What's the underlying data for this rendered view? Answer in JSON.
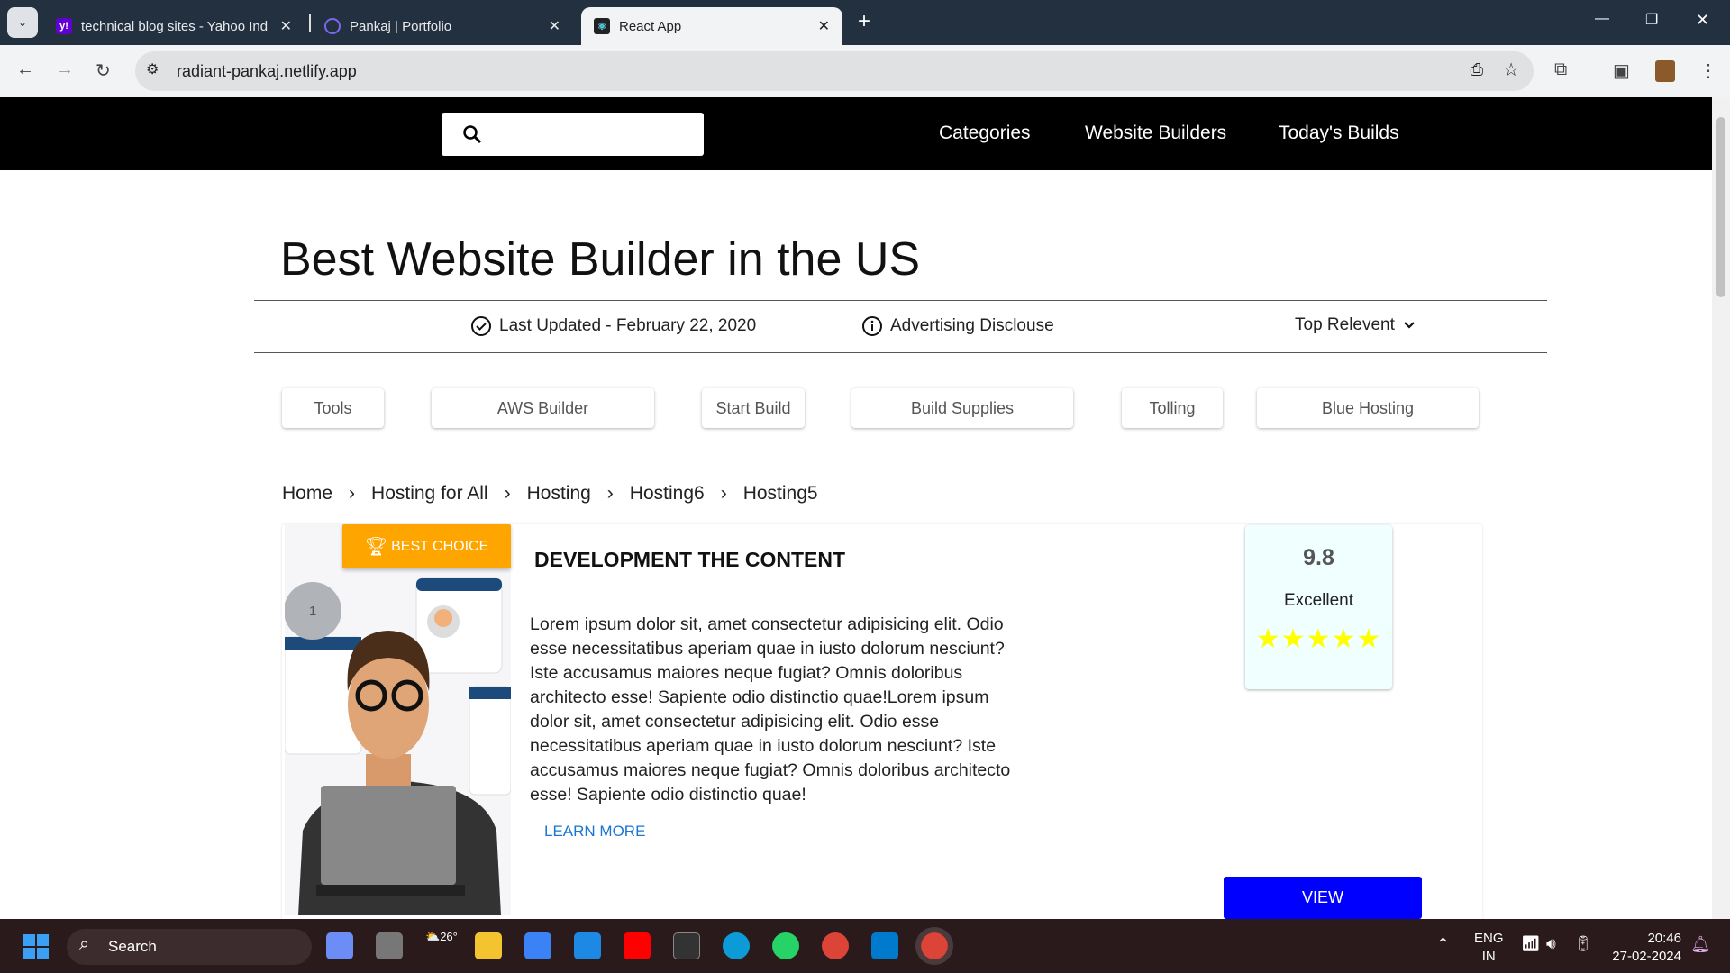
{
  "browser": {
    "tabs": [
      {
        "title": "technical blog sites - Yahoo Ind",
        "icon": "yahoo-icon"
      },
      {
        "title": "Pankaj | Portfolio",
        "icon": "portfolio-icon"
      },
      {
        "title": "React App",
        "icon": "react-icon",
        "active": true
      }
    ],
    "url": "radiant-pankaj.netlify.app"
  },
  "nav": {
    "links": [
      "Categories",
      "Website Builders",
      "Today's Builds"
    ]
  },
  "page": {
    "title": "Best Website Builder in the US",
    "last_updated": "Last Updated - February 22, 2020",
    "disclosure": "Advertising Disclouse",
    "sort": "Top Relevent",
    "filters": [
      "Tools",
      "AWS Builder",
      "Start Build",
      "Build Supplies",
      "Tolling",
      "Blue Hosting"
    ],
    "breadcrumb": [
      "Home",
      "Hosting for All",
      "Hosting",
      "Hosting6",
      "Hosting5"
    ]
  },
  "card": {
    "rank": "1",
    "badge": "BEST CHOICE",
    "heading": "DEVELOPMENT THE CONTENT",
    "description": "Lorem ipsum dolor sit, amet consectetur adipisicing elit. Odio esse necessitatibus aperiam quae in iusto dolorum nesciunt? Iste accusamus maiores neque fugiat? Omnis doloribus architecto esse! Sapiente odio distinctio quae!Lorem ipsum dolor sit, amet consectetur adipisicing elit. Odio esse necessitatibus aperiam quae in iusto dolorum nesciunt? Iste accusamus maiores neque fugiat? Omnis doloribus architecto esse! Sapiente odio distinctio quae!",
    "learn_more": "LEARN MORE",
    "score": "9.8",
    "score_label": "Excellent",
    "stars": 5,
    "view": "VIEW"
  },
  "taskbar": {
    "search": "Search",
    "weather": "26°",
    "lang1": "ENG",
    "lang2": "IN",
    "time": "20:46",
    "date": "27-02-2024"
  },
  "colors": {
    "badge": "#ffa500",
    "view": "#0000ff",
    "link": "#1976d2",
    "star": "#ffff00",
    "rating_bg": "#f0ffff"
  }
}
